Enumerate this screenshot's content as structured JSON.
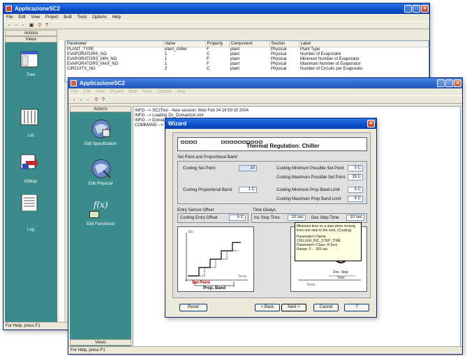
{
  "back_window": {
    "title": "ApplicazioneSC2",
    "menu": [
      "File",
      "Edit",
      "View",
      "Project",
      "Built",
      "Tools",
      "Options",
      "Help"
    ],
    "sidebar": {
      "header_top": "Actions",
      "header_sub": "Views",
      "items": [
        {
          "label": "Tree",
          "icon": "tree-view-icon"
        },
        {
          "label": "List",
          "icon": "list-view-icon"
        },
        {
          "label": "IOMap",
          "icon": "iomap-icon"
        },
        {
          "label": "Log",
          "icon": "log-icon"
        }
      ]
    },
    "table": {
      "columns": [
        "Parameter",
        "Value",
        "Property",
        "Component",
        "Section",
        "Label"
      ],
      "rows": [
        [
          "PLANT_TYPE",
          "plant_chiller",
          "F",
          "plant",
          "Physical",
          "Plant Type"
        ],
        [
          "EVAPORATORS_NO",
          "1",
          "C",
          "plant",
          "Physical",
          "Number of Evaporator"
        ],
        [
          "EVAPORATORS_MIN_NO",
          "1",
          "F",
          "plant",
          "Physical",
          "Minimum Number of Evaporator"
        ],
        [
          "EVAPORATORS_MAX_NO",
          "1",
          "F",
          "plant",
          "Physical",
          "Maximum Number of Evaporator"
        ],
        [
          "CIRCUITS_NO",
          "2",
          "C",
          "plant",
          "Physical",
          "Number of Circuits per Evaporato"
        ]
      ]
    },
    "status": "For Help, press F1"
  },
  "front_window": {
    "title": "ApplicazioneSC2",
    "sidebar": {
      "header_top": "Actions",
      "footer": "Views",
      "items": [
        {
          "label": "Edit Specification",
          "icon": "edit-specification-icon"
        },
        {
          "label": "Edit Physical",
          "icon": "edit-physical-icon"
        },
        {
          "label": "Edit Functional",
          "icon": "edit-functional-icon",
          "glyph": "f(x)"
        }
      ]
    },
    "log_lines": [
      "INFO --> SC2Tool - New session: Wed Feb 04 16:59:15 2004",
      "INFO --> Loading Ds_DomainLib.xml",
      "INFO --> DomainLib...",
      "COMMAND --> W..."
    ],
    "status": "For Help, press F1"
  },
  "wizard": {
    "title": "Wizard",
    "heading": "Thermal Regulation: Chiller",
    "group_setpoint": "Set Point and Proportional Band",
    "fields_left": [
      {
        "label": "Cooling Set Point",
        "value": "12"
      },
      {
        "label": "Cooling Proportional Band",
        "value": "1 C"
      }
    ],
    "fields_right": [
      {
        "label": "Cooling Minimum Possible Set Point",
        "value": "5 C"
      },
      {
        "label": "Cooling Maximum Possible Set Point",
        "value": "15 C"
      },
      {
        "label": "Cooling Minimum Prop Band Limit",
        "value": "5 C"
      },
      {
        "label": "Cooling Maximum Prop Band Limit",
        "value": "5 C"
      }
    ],
    "group_entry": "Entry Sensor Offset",
    "entry_offset": {
      "label": "Cooling Entry Offset",
      "value": "5 C"
    },
    "group_delay": "Time Delays",
    "inc_step": {
      "label": "Inc Step Time",
      "value": "10 sec"
    },
    "dec_step": {
      "label": "Dec Step Time",
      "value": "10 sec"
    },
    "tooltip": {
      "line1": "Minimum time on a step when moving",
      "line2": "from one step to the next. (Cooling)",
      "line3": "Parameter's Name:",
      "line4": "CHILLER_INC_STEP_TIME",
      "line5": "Parameter's Class: H (Inc)",
      "line6": "Range: 0 ... 360 sec"
    },
    "diagram_left": {
      "y_label": "Stp",
      "x_label": "Temp",
      "setpoint_label": "Set Point",
      "band_label": "Prop. Band"
    },
    "diagram_right": {
      "x_label": "Temp",
      "step_label": "Dec. Step",
      "time_label": "Time"
    },
    "buttons": {
      "reset": "Reset",
      "back": "< Back",
      "next": "Next >",
      "cancel": "Cancel",
      "help": "?"
    }
  }
}
